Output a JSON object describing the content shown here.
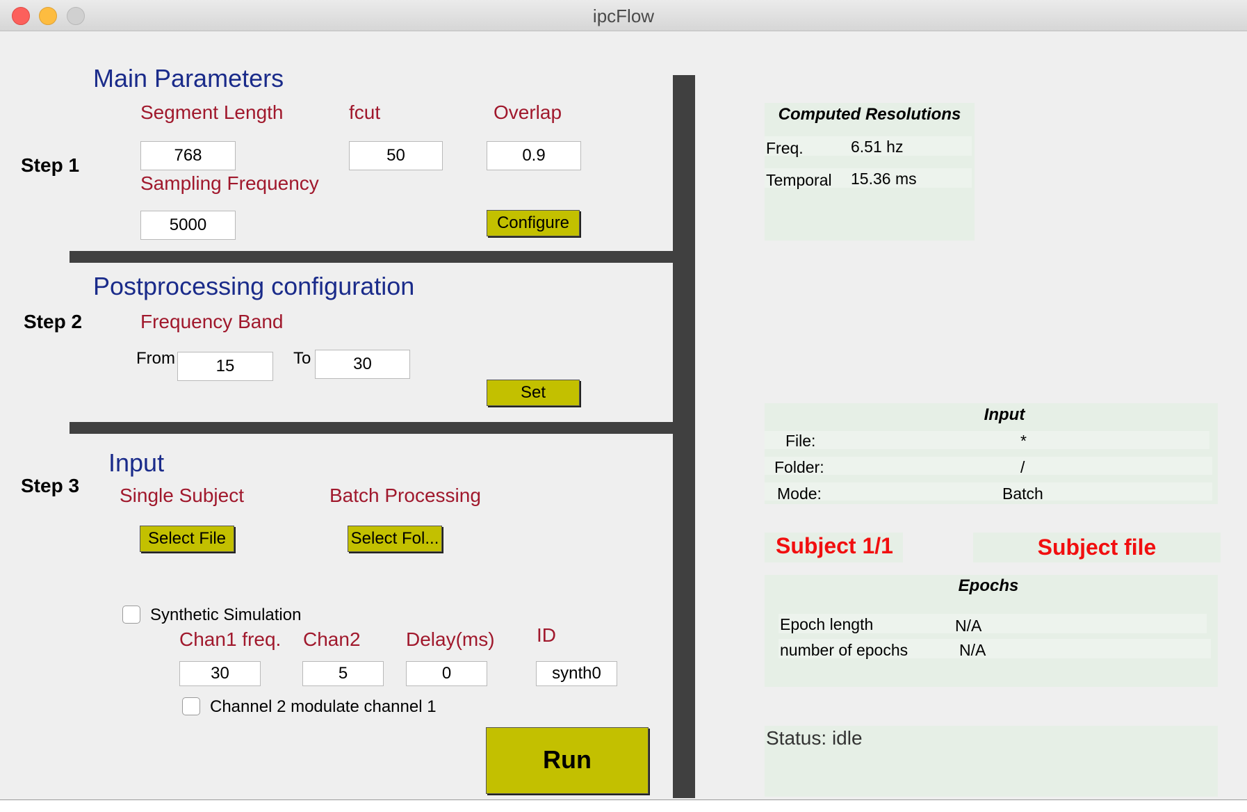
{
  "window": {
    "title": "ipcFlow"
  },
  "step1": {
    "step_label": "Step 1",
    "heading": "Main Parameters",
    "segment_length_label": "Segment Length",
    "segment_length_value": "768",
    "fcut_label": "fcut",
    "fcut_value": "50",
    "overlap_label": "Overlap",
    "overlap_value": "0.9",
    "sampling_frequency_label": "Sampling Frequency",
    "sampling_frequency_value": "5000",
    "configure_button": "Configure"
  },
  "step2": {
    "step_label": "Step 2",
    "heading": "Postprocessing configuration",
    "frequency_band_label": "Frequency Band",
    "from_label": "From",
    "from_value": "15",
    "to_label": "To",
    "to_value": "30",
    "set_button": "Set"
  },
  "step3": {
    "step_label": "Step 3",
    "heading": "Input",
    "single_subject_label": "Single Subject",
    "select_file_button": "Select File",
    "batch_processing_label": "Batch Processing",
    "select_folder_button": "Select Fol...",
    "synthetic_label": "Synthetic Simulation",
    "synthetic_checked": false,
    "chan1_label": "Chan1 freq.",
    "chan1_value": "30",
    "chan2_label": "Chan2",
    "chan2_value": "5",
    "delay_label": "Delay(ms)",
    "delay_value": "0",
    "id_label": "ID",
    "id_value": "synth0",
    "modulate_label": "Channel 2 modulate channel 1",
    "modulate_checked": false,
    "run_button": "Run"
  },
  "resolutions": {
    "title": "Computed Resolutions",
    "freq_label": "Freq.",
    "freq_value": "6.51 hz",
    "temporal_label": "Temporal",
    "temporal_value": "15.36 ms"
  },
  "input_panel": {
    "title": "Input",
    "file_label": "File:",
    "file_value": "*",
    "folder_label": "Folder:",
    "folder_value": "/",
    "mode_label": "Mode:",
    "mode_value": "Batch"
  },
  "subject": {
    "counter": "Subject 1/1",
    "file": "Subject file"
  },
  "epochs": {
    "title": "Epochs",
    "length_label": "Epoch length",
    "length_value": "N/A",
    "count_label": "number of epochs",
    "count_value": "N/A"
  },
  "status": {
    "text": "Status: idle"
  },
  "colors": {
    "button": "#c3c000",
    "label": "#a0182c",
    "heading": "#1a2b8a",
    "alert": "#f10f0f",
    "panel": "#e6efe6"
  }
}
